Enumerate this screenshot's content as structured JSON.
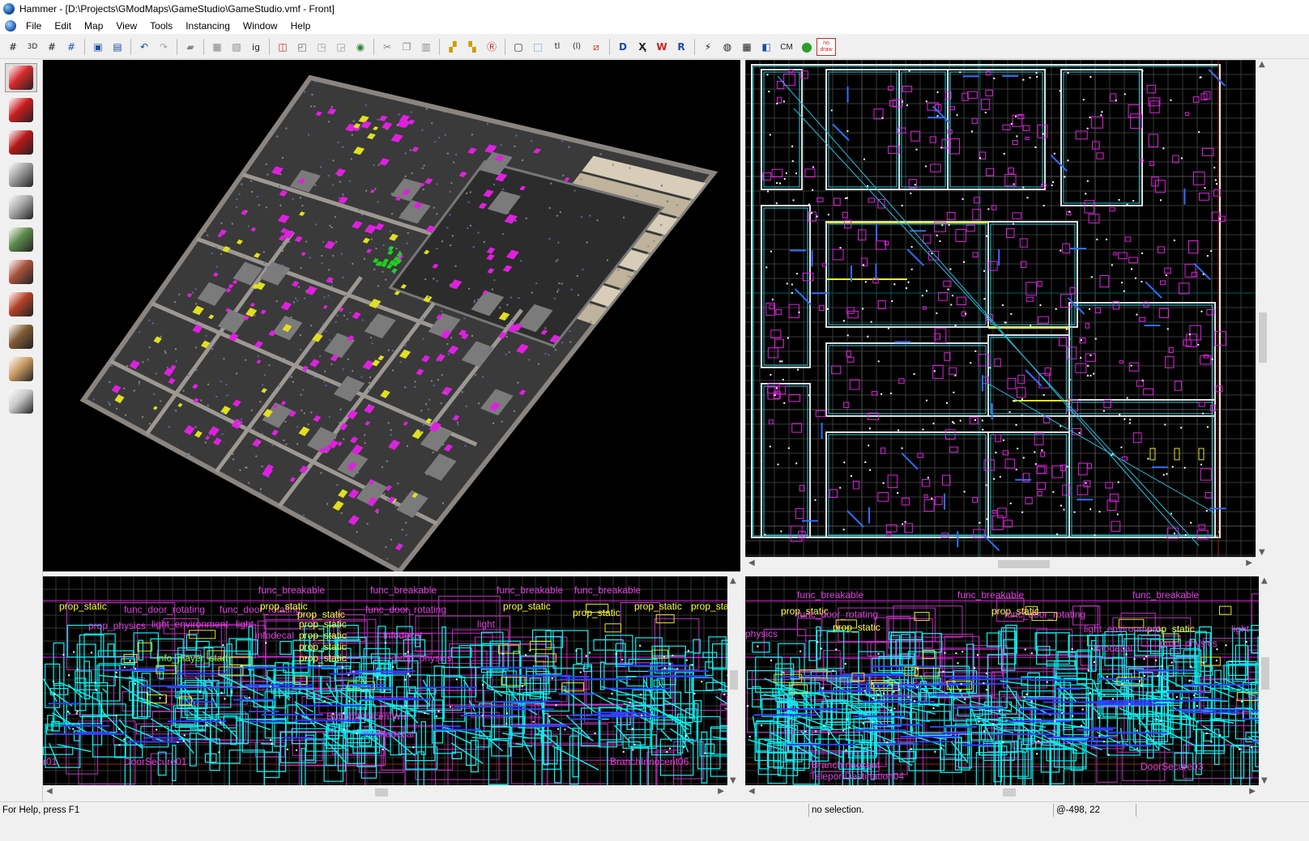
{
  "window": {
    "title": "Hammer - [D:\\Projects\\GModMaps\\GameStudio\\GameStudio.vmf - Front]"
  },
  "menu": [
    "File",
    "Edit",
    "Map",
    "View",
    "Tools",
    "Instancing",
    "Window",
    "Help"
  ],
  "toolbar": {
    "cm_label": "CM",
    "nodraw_line1": "no",
    "nodraw_line2": "draw"
  },
  "palette": [
    {
      "name": "selection-tool",
      "icon": "arrow-icon",
      "color": "#d42a2a"
    },
    {
      "name": "magnify-tool",
      "icon": "magnify-icon",
      "color": "#c91c1c"
    },
    {
      "name": "camera-tool",
      "icon": "camera-icon",
      "color": "#b71818"
    },
    {
      "name": "entity-tool",
      "icon": "entity-icon",
      "color": "#9c9c9c"
    },
    {
      "name": "block-tool",
      "icon": "block-icon",
      "color": "#a7a7a7"
    },
    {
      "name": "texture-app-tool",
      "icon": "texture-icon",
      "color": "#5c8a4a"
    },
    {
      "name": "apply-texture-tool",
      "icon": "apply-texture-icon",
      "color": "#a6513a"
    },
    {
      "name": "decal-tool",
      "icon": "decal-icon",
      "color": "#b24027"
    },
    {
      "name": "overlay-tool",
      "icon": "overlay-icon",
      "color": "#7e5a33"
    },
    {
      "name": "clip-tool",
      "icon": "clip-icon",
      "color": "#c99a63"
    },
    {
      "name": "vertex-tool",
      "icon": "vertex-icon",
      "color": "#c7c7c7"
    }
  ],
  "viewports": {
    "front_labels": [
      {
        "t": "func_breakable",
        "c": "#e040e0"
      },
      {
        "t": "func_breakable",
        "c": "#e040e0"
      },
      {
        "t": "func_breakable",
        "c": "#e040e0"
      },
      {
        "t": "func_breakable",
        "c": "#e040e0"
      },
      {
        "t": "prop_static",
        "c": "#ffff40"
      },
      {
        "t": "func_door_rotating",
        "c": "#e040e0"
      },
      {
        "t": "func_door_rotating",
        "c": "#e040e0"
      },
      {
        "t": "prop_static",
        "c": "#ffff40"
      },
      {
        "t": "prop_static",
        "c": "#ffff40"
      },
      {
        "t": "func_door_rotating",
        "c": "#e040e0"
      },
      {
        "t": "prop_static",
        "c": "#ffff40"
      },
      {
        "t": "prop_static",
        "c": "#ffff40"
      },
      {
        "t": "prop_static",
        "c": "#ffff40"
      },
      {
        "t": "prop_static",
        "c": "#ffff40"
      },
      {
        "t": "prop_physics",
        "c": "#e040e0"
      },
      {
        "t": "light_environment",
        "c": "#e040e0"
      },
      {
        "t": "light",
        "c": "#e040e0"
      },
      {
        "t": "prop_static",
        "c": "#ffff40"
      },
      {
        "t": "light",
        "c": "#e040e0"
      },
      {
        "t": "prop_static",
        "c": "#ffff40"
      },
      {
        "t": "prop_static",
        "c": "#ffff40"
      },
      {
        "t": "prop_static",
        "c": "#ffff40"
      },
      {
        "t": "infodecal",
        "c": "#e040e0"
      },
      {
        "t": "infodecal",
        "c": "#e040e0"
      },
      {
        "t": "info_player_start",
        "c": "#80ff40"
      },
      {
        "t": "prop_physics",
        "c": "#e040e0"
      },
      {
        "t": "ButtonInnocentWin",
        "c": "#e040e0"
      },
      {
        "t": "infodecal",
        "c": "#e040e0"
      },
      {
        "t": "BranchInnocent06",
        "c": "#e040e0"
      },
      {
        "t": "DoorSecure01",
        "c": "#e040e0"
      },
      {
        "t": "r01",
        "c": "#e040e0"
      }
    ],
    "side_labels": [
      {
        "t": "func_breakable",
        "c": "#e040e0"
      },
      {
        "t": "func_breakable",
        "c": "#e040e0"
      },
      {
        "t": "func_breakable",
        "c": "#e040e0"
      },
      {
        "t": "prop_static",
        "c": "#ffff40"
      },
      {
        "t": "prop_static",
        "c": "#ffff40"
      },
      {
        "t": "func_door_rotating",
        "c": "#e040e0"
      },
      {
        "t": "func_door_rotating",
        "c": "#e040e0"
      },
      {
        "t": "prop_static",
        "c": "#ffff40"
      },
      {
        "t": "prop_static",
        "c": "#ffff40"
      },
      {
        "t": "light_environment",
        "c": "#e040e0"
      },
      {
        "t": "light",
        "c": "#e040e0"
      },
      {
        "t": "physics",
        "c": "#e040e0"
      },
      {
        "t": "infodecal",
        "c": "#e040e0"
      },
      {
        "t": "prop_physics",
        "c": "#e040e0"
      },
      {
        "t": "BranchInnocent",
        "c": "#e040e0"
      },
      {
        "t": "TeleportDestination04",
        "c": "#e040e0"
      },
      {
        "t": "DoorSecure03",
        "c": "#e040e0"
      }
    ]
  },
  "status": {
    "help": "For Help, press F1",
    "selection": "no selection.",
    "coords": "@-498, 22"
  }
}
